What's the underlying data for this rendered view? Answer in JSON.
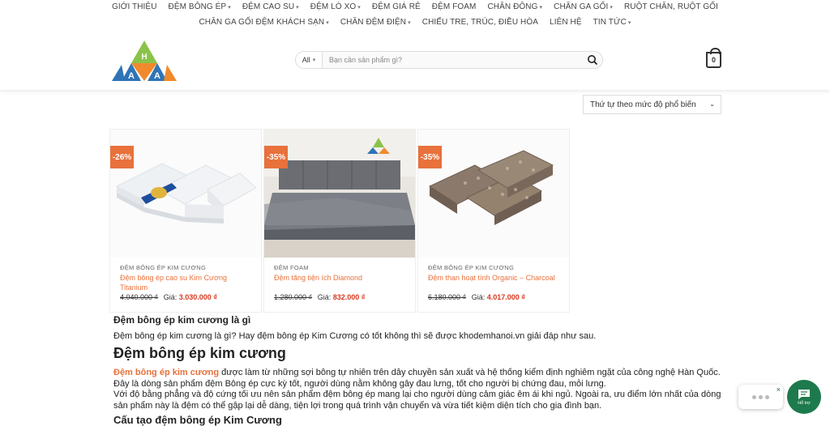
{
  "nav": {
    "row1": [
      {
        "label": "GIỚI THIỆU",
        "dropdown": false
      },
      {
        "label": "ĐỆM BÔNG ÉP",
        "dropdown": true
      },
      {
        "label": "ĐỆM CAO SU",
        "dropdown": true
      },
      {
        "label": "ĐỆM LÒ XO",
        "dropdown": true
      },
      {
        "label": "ĐỆM GIÁ RẺ",
        "dropdown": false
      },
      {
        "label": "ĐỆM FOAM",
        "dropdown": false
      },
      {
        "label": "CHĂN ĐÔNG",
        "dropdown": true
      },
      {
        "label": "CHĂN GA GỐI",
        "dropdown": true
      },
      {
        "label": "RUỘT CHĂN, RUỘT GỐI",
        "dropdown": false
      }
    ],
    "row2": [
      {
        "label": "CHĂN GA GỐI ĐỆM KHÁCH SẠN",
        "dropdown": true
      },
      {
        "label": "CHĂN ĐỆM ĐIỆN",
        "dropdown": true
      },
      {
        "label": "CHIẾU TRE, TRÚC, ĐIỀU HÒA",
        "dropdown": false
      },
      {
        "label": "LIÊN HỆ",
        "dropdown": false
      },
      {
        "label": "TIN TỨC",
        "dropdown": true
      }
    ]
  },
  "header": {
    "logo_letters": {
      "top": "H",
      "left": "A",
      "right": "A"
    },
    "search": {
      "category": "All",
      "placeholder": "Bạn cần sản phẩm gì?"
    },
    "cart_count": "0"
  },
  "sort": {
    "selected": "Thứ tự theo mức độ phổ biến"
  },
  "products": [
    {
      "discount": "-26%",
      "category": "ĐỆM BÔNG ÉP KIM CƯƠNG",
      "name": "Đệm bông ép cao su Kim Cương Titanium",
      "old_price": "4.040.000 ₫",
      "price_label": "Giá:",
      "new_price": "3.030.000 ₫"
    },
    {
      "discount": "-35%",
      "category": "ĐỆM FOAM",
      "name": "Đệm tăng tiện ích Diamond",
      "old_price": "1.280.000 ₫",
      "price_label": "Giá:",
      "new_price": "832.000 ₫"
    },
    {
      "discount": "-35%",
      "category": "ĐỆM BÔNG ÉP KIM CƯƠNG",
      "name": "Đệm than hoạt tính Organic – Charcoal",
      "old_price": "6.180.000 ₫",
      "price_label": "Giá:",
      "new_price": "4.017.000 ₫"
    }
  ],
  "article": {
    "h3": "Đệm bông ép kim cương là gì",
    "intro": "Đệm bông ép kim cương là gì? Hay đệm bông ép Kim Cương có tốt không thì sẽ được khodemhanoi.vn giải đáp như sau.",
    "h2": "Đệm bông ép kim cương",
    "p1_highlight": "Đệm bông ép kim cương",
    "p1_rest": " được làm từ những sợi bông tự nhiên trên dây chuyền sản xuất và hệ thống kiểm định nghiêm ngặt của công nghệ Hàn Quốc. Đây là dòng sản phẩm đệm Bông ép cực kỳ tốt, người dùng nằm không gây đau lưng, tốt cho người bị chứng đau, mỏi lưng.",
    "p2": "Với độ bằng phẳng và độ cứng tối ưu nên sản phẩm đệm bông ép mang lại cho người dùng cảm giác êm ái khi ngủ. Ngoài ra, ưu điểm lớn nhất của dòng sản phẩm này là đệm có thể gập lại dễ dàng, tiện lợi trong quá trình vận chuyển và vừa tiết kiệm diện tích cho gia đình bạn.",
    "h4": "Cấu tạo đệm bông ép Kim Cương"
  },
  "chat": {
    "close": "×",
    "button_label": "Hỗ trợ"
  },
  "colors": {
    "accent": "#e8713c",
    "sale": "#d9381e",
    "chat": "#1d7a4c"
  }
}
